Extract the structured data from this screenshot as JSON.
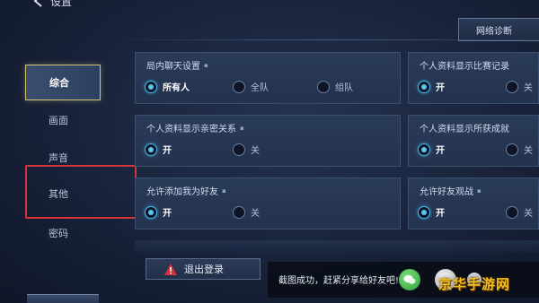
{
  "header": {
    "title": "设置",
    "network_button": "网络诊断"
  },
  "sidebar": {
    "items": [
      {
        "label": "综合",
        "active": true
      },
      {
        "label": "画面",
        "active": false
      },
      {
        "label": "声音",
        "active": false
      },
      {
        "label": "其他",
        "active": false,
        "highlighted": true
      },
      {
        "label": "密码",
        "active": false
      }
    ]
  },
  "panels": [
    {
      "title": "局内聊天设置",
      "options": [
        {
          "label": "所有人",
          "selected": true
        },
        {
          "label": "全队",
          "selected": false
        },
        {
          "label": "组队",
          "selected": false
        }
      ]
    },
    {
      "title": "个人资料显示比赛记录",
      "options": [
        {
          "label": "开",
          "selected": true
        },
        {
          "label": "关",
          "selected": false
        }
      ]
    },
    {
      "title": "个人资料显示亲密关系",
      "options": [
        {
          "label": "开",
          "selected": true
        },
        {
          "label": "关",
          "selected": false
        }
      ]
    },
    {
      "title": "个人资料显示所获成就",
      "options": [
        {
          "label": "开",
          "selected": true
        },
        {
          "label": "关",
          "selected": false
        }
      ]
    },
    {
      "title": "允许添加我为好友",
      "options": [
        {
          "label": "开",
          "selected": true
        },
        {
          "label": "关",
          "selected": false
        }
      ]
    },
    {
      "title": "允许好友观战",
      "options": [
        {
          "label": "开",
          "selected": true
        },
        {
          "label": "关",
          "selected": false
        }
      ]
    }
  ],
  "footer": {
    "logout_label": "退出登录",
    "toast_text": "截图成功，赶紧分享给好友吧!",
    "close_glyph": "×"
  },
  "watermark": "京华手游网",
  "colors": {
    "accent_border": "#d7c27a",
    "radio_on": "#59c6f2",
    "highlight_box": "#d6333a",
    "watermark": "#f3c01d"
  }
}
